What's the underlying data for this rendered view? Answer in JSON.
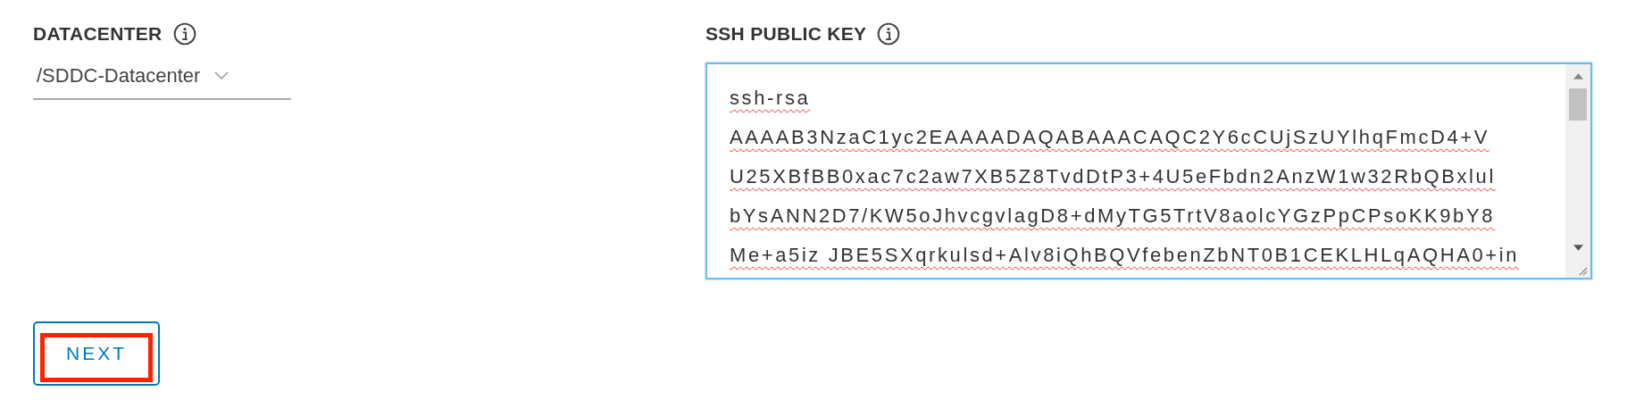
{
  "datacenter": {
    "label": "DATACENTER",
    "value": "/SDDC-Datacenter"
  },
  "ssh_public_key": {
    "label": "SSH PUBLIC KEY",
    "focused": true,
    "lines": [
      "ssh-rsa",
      "AAAAB3NzaC1yc2EAAAADAQABAAACAQC2Y6cCUjSzUYlhqFmcD4+V",
      "U25XBfBB0xac7c2aw7XB5Z8TvdDtP3+4U5eFbdn2AnzW1w32RbQBxlul",
      "bYsANN2D7/KW5oJhvcgvlagD8+dMyTG5TrtV8aolcYGzPpCPsoKK9bY8",
      "Me+a5iz JBE5SXqrkulsd+Alv8iQhBQVfebenZbNT0B1CEKLHLqAQHA0+in"
    ]
  },
  "next_button": {
    "label": "NEXT",
    "highlighted": true
  }
}
